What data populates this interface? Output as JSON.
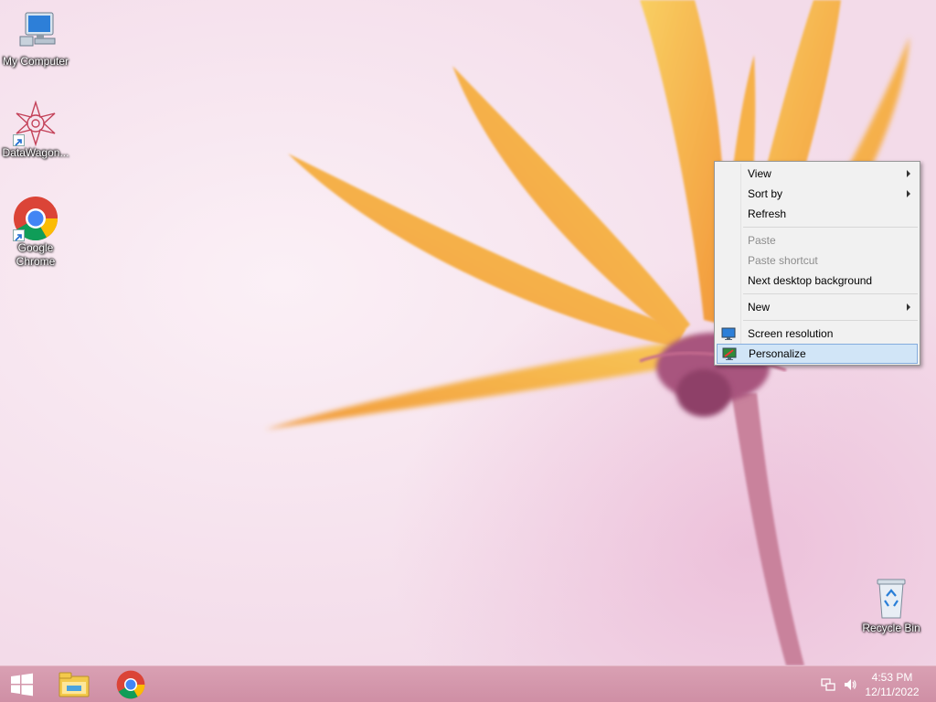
{
  "desktop": {
    "icons": [
      {
        "label": "My Computer",
        "icon": "computer-icon"
      },
      {
        "label": "DataWagon...",
        "icon": "datawagon-app-icon"
      },
      {
        "label": "Google Chrome",
        "icon": "chrome-icon"
      },
      {
        "label": "Recycle Bin",
        "icon": "recycle-bin-icon"
      }
    ]
  },
  "context_menu": {
    "items": [
      {
        "label": "View",
        "submenu": true,
        "enabled": true
      },
      {
        "label": "Sort by",
        "submenu": true,
        "enabled": true
      },
      {
        "label": "Refresh",
        "enabled": true
      },
      {
        "label": "Paste",
        "enabled": false
      },
      {
        "label": "Paste shortcut",
        "enabled": false
      },
      {
        "label": "Next desktop background",
        "enabled": true
      },
      {
        "label": "New",
        "submenu": true,
        "enabled": true
      },
      {
        "label": "Screen resolution",
        "enabled": true,
        "icon": "display-icon"
      },
      {
        "label": "Personalize",
        "enabled": true,
        "icon": "personalize-icon",
        "highlighted": true
      }
    ]
  },
  "taskbar": {
    "start": {
      "icon": "windows-logo-icon"
    },
    "pinned": [
      {
        "icon": "file-explorer-icon"
      },
      {
        "icon": "chrome-icon"
      }
    ],
    "tray": {
      "network_icon": "network-icon",
      "volume_icon": "volume-icon"
    },
    "clock": {
      "time": "4:53 PM",
      "date": "12/11/2022"
    }
  },
  "colors": {
    "menu_highlight": "#d1e5f7",
    "menu_highlight_border": "#84acdd",
    "taskbar": "#d49aae"
  }
}
